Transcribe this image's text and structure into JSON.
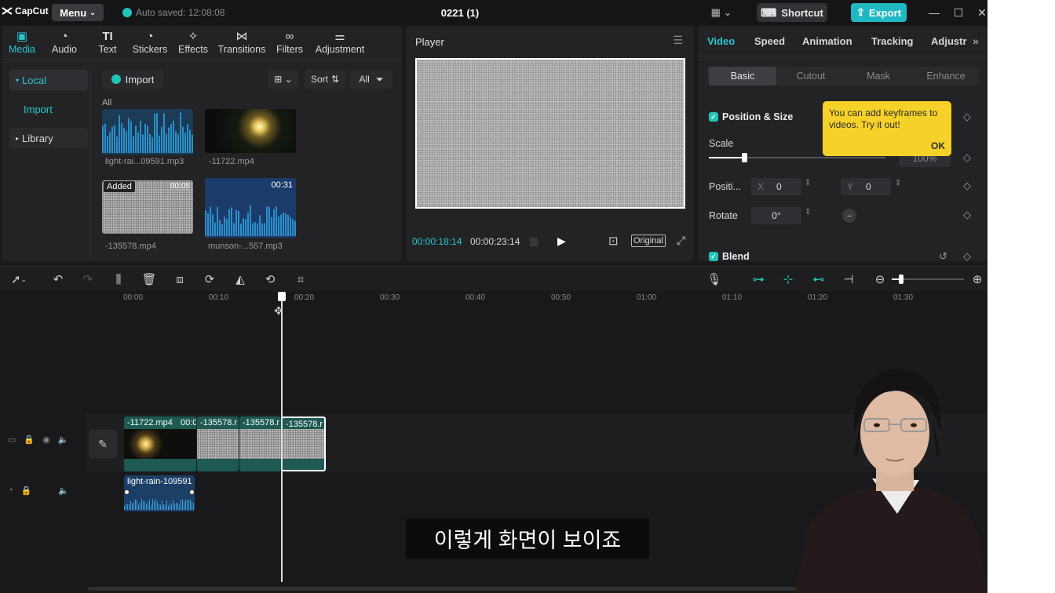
{
  "app": {
    "logo": "CapCut",
    "menu_label": "Menu",
    "autosave": "Auto saved: 12:08:08",
    "project_title": "0221 (1)",
    "shortcut_label": "Shortcut",
    "export_label": "Export",
    "accent": "#22c3b8"
  },
  "toolbar": {
    "items": [
      {
        "label": "Media",
        "icon": "media-icon"
      },
      {
        "label": "Audio",
        "icon": "audio-icon"
      },
      {
        "label": "Text",
        "icon": "text-icon"
      },
      {
        "label": "Stickers",
        "icon": "stickers-icon"
      },
      {
        "label": "Effects",
        "icon": "effects-icon"
      },
      {
        "label": "Transitions",
        "icon": "transitions-icon"
      },
      {
        "label": "Filters",
        "icon": "filters-icon"
      },
      {
        "label": "Adjustment",
        "icon": "adjustment-icon"
      }
    ]
  },
  "media": {
    "sidebar": {
      "local": "Local",
      "import": "Import",
      "library": "Library"
    },
    "import_label": "Import",
    "sort_label": "Sort",
    "all_filter": "All",
    "section_label": "All",
    "items": [
      {
        "name": "light-rai...09591.mp3",
        "badge": "",
        "duration": ""
      },
      {
        "name": "-11722.mp4",
        "badge": "",
        "duration": ""
      },
      {
        "name": "-135578.mp4",
        "badge": "Added",
        "duration": "00:05"
      },
      {
        "name": "munson-...557.mp3",
        "badge": "",
        "duration": "00:31"
      }
    ]
  },
  "player": {
    "title": "Player",
    "current_time": "00:00:18:14",
    "total_time": "00:00:23:14",
    "ratio_label": "Original"
  },
  "inspector": {
    "tabs": [
      "Video",
      "Speed",
      "Animation",
      "Tracking",
      "Adjustr"
    ],
    "subtabs": [
      "Basic",
      "Cutout",
      "Mask",
      "Enhance"
    ],
    "position_size": "Position & Size",
    "tooltip_text": "You can add keyframes to videos. Try it out!",
    "tooltip_ok": "OK",
    "scale_label": "Scale",
    "scale_value": "100%",
    "scale_fraction": 0.2,
    "position_label": "Positi...",
    "x_label": "X",
    "x_value": "0",
    "y_label": "Y",
    "y_value": "0",
    "rotate_label": "Rotate",
    "rotate_value": "0°",
    "blend_label": "Blend"
  },
  "timeline": {
    "ruler": [
      "00:00",
      "00:10",
      "00:20",
      "00:30",
      "00:40",
      "00:50",
      "01:00",
      "01:10",
      "01:20",
      "01:30"
    ],
    "video_clips": [
      "-11722.mp4",
      "00:0",
      "-135578.r",
      "-135578.r",
      "-135578.r"
    ],
    "audio_clip": "light-rain-109591"
  },
  "subtitle": "이렇게 화면이 보이죠"
}
